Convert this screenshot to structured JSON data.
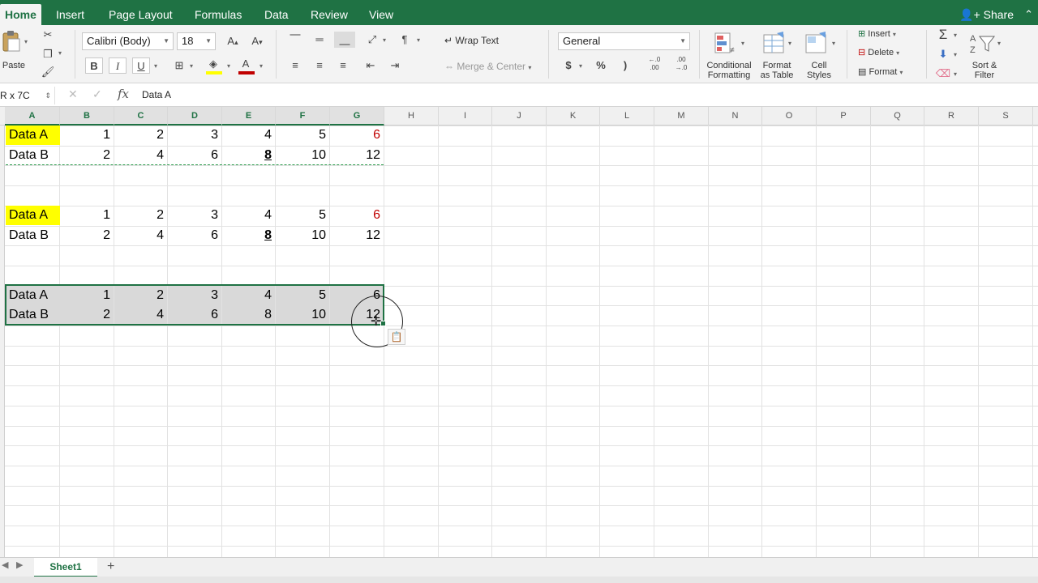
{
  "tabs": [
    "Home",
    "Insert",
    "Page Layout",
    "Formulas",
    "Data",
    "Review",
    "View"
  ],
  "active_tab": "Home",
  "share_label": "Share",
  "clipboard": {
    "paste_label": "Paste"
  },
  "font": {
    "name": "Calibri (Body)",
    "size": "18",
    "bold": "B",
    "italic": "I",
    "underline": "U"
  },
  "alignment": {
    "wrap_text": "Wrap Text",
    "merge_center": "Merge & Center"
  },
  "number": {
    "format": "General",
    "currency": "$",
    "percent": "%",
    "comma": ")",
    "inc_decimal": "←.0\n.00",
    "dec_decimal": ".00\n→.0"
  },
  "styles": {
    "conditional": [
      "Conditional",
      "Formatting"
    ],
    "format_table": [
      "Format",
      "as Table"
    ],
    "cell_styles": [
      "Cell",
      "Styles"
    ]
  },
  "cells_group": {
    "insert": "Insert",
    "delete": "Delete",
    "format": "Format"
  },
  "editing": {
    "sort_filter": [
      "Sort &",
      "Filter"
    ]
  },
  "formula_bar": {
    "name_box": "R x 7C",
    "fx": "fx",
    "content": "Data A"
  },
  "columns": [
    "A",
    "B",
    "C",
    "D",
    "E",
    "F",
    "G",
    "H",
    "I",
    "J",
    "K",
    "L",
    "M",
    "N",
    "O",
    "P",
    "Q",
    "R",
    "S"
  ],
  "blocks": [
    {
      "rows": [
        {
          "label": "Data A",
          "values": [
            "1",
            "2",
            "3",
            "4",
            "5",
            "6"
          ]
        },
        {
          "label": "Data B",
          "values": [
            "2",
            "4",
            "6",
            "8",
            "10",
            "12"
          ]
        }
      ]
    },
    {
      "rows": [
        {
          "label": "Data A",
          "values": [
            "1",
            "2",
            "3",
            "4",
            "5",
            "6"
          ]
        },
        {
          "label": "Data B",
          "values": [
            "2",
            "4",
            "6",
            "8",
            "10",
            "12"
          ]
        }
      ]
    },
    {
      "rows": [
        {
          "label": "Data A",
          "values": [
            "1",
            "2",
            "3",
            "4",
            "5",
            "6"
          ]
        },
        {
          "label": "Data B",
          "values": [
            "2",
            "4",
            "6",
            "8",
            "10",
            "12"
          ]
        }
      ]
    }
  ],
  "sheet_tab": "Sheet1",
  "add_sheet": "+",
  "colors": {
    "accent": "#1f7244",
    "highlight": "#ffff00",
    "red_text": "#c00000",
    "selection_fill": "#d9d9d9"
  }
}
